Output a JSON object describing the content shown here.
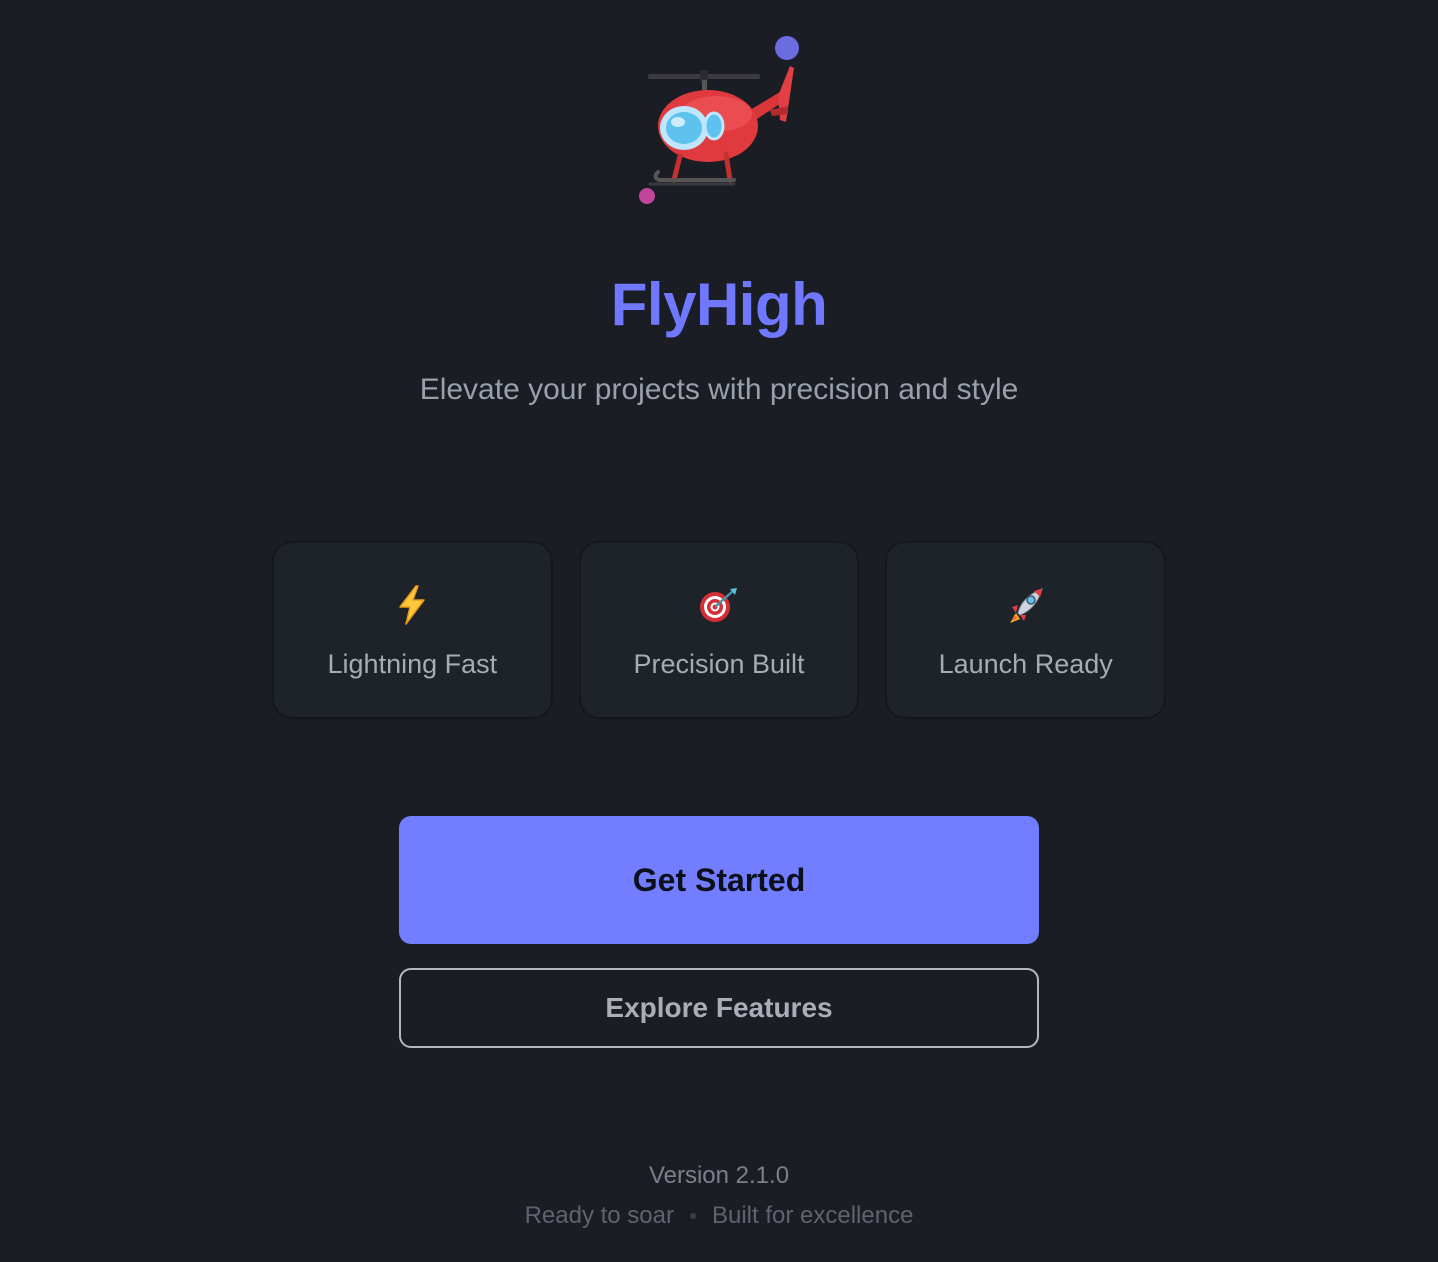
{
  "brand": {
    "title": "FlyHigh",
    "tagline": "Elevate your projects with precision and style",
    "accent_color": "#737dff",
    "hero_icon": "helicopter-icon"
  },
  "features": [
    {
      "icon": "lightning-icon",
      "label": "Lightning Fast"
    },
    {
      "icon": "target-icon",
      "label": "Precision Built"
    },
    {
      "icon": "rocket-icon",
      "label": "Launch Ready"
    }
  ],
  "actions": {
    "primary_label": "Get Started",
    "secondary_label": "Explore Features"
  },
  "footer": {
    "version": "Version 2.1.0",
    "left_text": "Ready to soar",
    "right_text": "Built for excellence"
  }
}
